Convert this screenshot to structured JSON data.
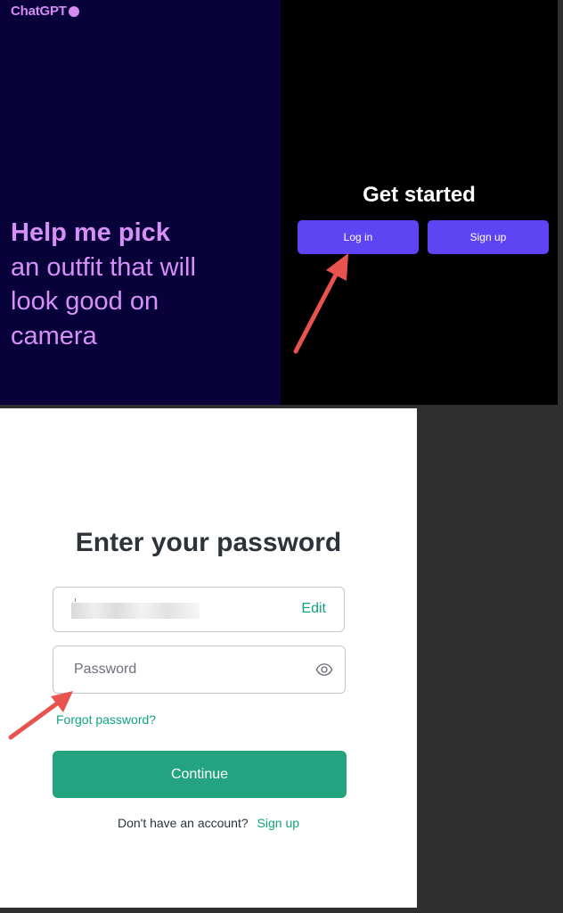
{
  "top": {
    "logo_text": "ChatGPT",
    "headline_strong": "Help me pick",
    "headline_rest_1": "an outfit that will",
    "headline_rest_2": "look good on",
    "headline_rest_3": "camera",
    "get_started": "Get started",
    "login_label": "Log in",
    "signup_label": "Sign up"
  },
  "login": {
    "title": "Enter your password",
    "edit_label": "Edit",
    "password_placeholder": "Password",
    "forgot_label": "Forgot password?",
    "continue_label": "Continue",
    "no_account_text": "Don't have an account?",
    "signup_link": "Sign up"
  },
  "colors": {
    "left_panel_bg": "#08013a",
    "headline_color": "#d690f6",
    "top_button": "#5e44f2",
    "accent_green": "#10a37f",
    "continue_bg": "#23a47f",
    "annotation_arrow": "#e8534f"
  },
  "icons": {
    "logo_dot": "circle-icon",
    "password_toggle": "eye-icon",
    "annotation": "arrow-icon"
  }
}
